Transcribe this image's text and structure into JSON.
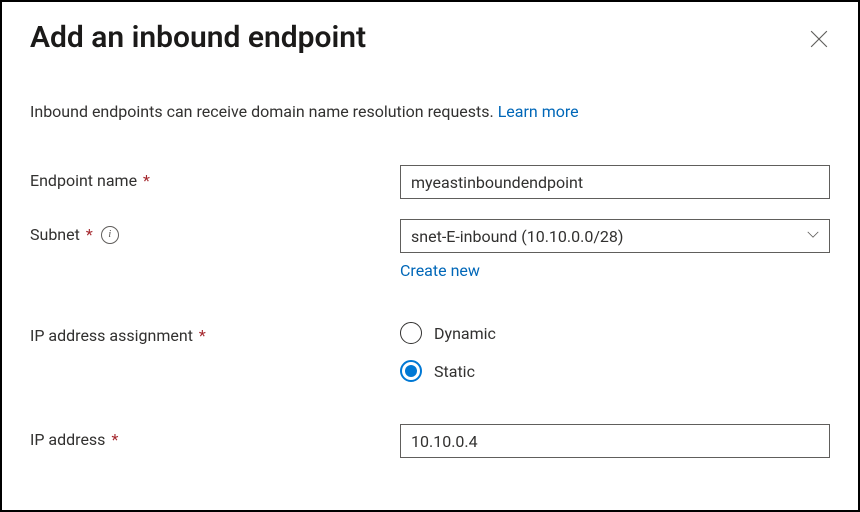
{
  "header": {
    "title": "Add an inbound endpoint"
  },
  "description": {
    "text": "Inbound endpoints can receive domain name resolution requests. ",
    "learn_more": "Learn more"
  },
  "fields": {
    "endpoint_name": {
      "label": "Endpoint name",
      "value": "myeastinboundendpoint"
    },
    "subnet": {
      "label": "Subnet",
      "value": "snet-E-inbound (10.10.0.0/28)",
      "create_new": "Create new"
    },
    "ip_assignment": {
      "label": "IP address assignment",
      "options": {
        "dynamic": "Dynamic",
        "static": "Static"
      },
      "selected": "static"
    },
    "ip_address": {
      "label": "IP address",
      "value": "10.10.0.4"
    }
  }
}
